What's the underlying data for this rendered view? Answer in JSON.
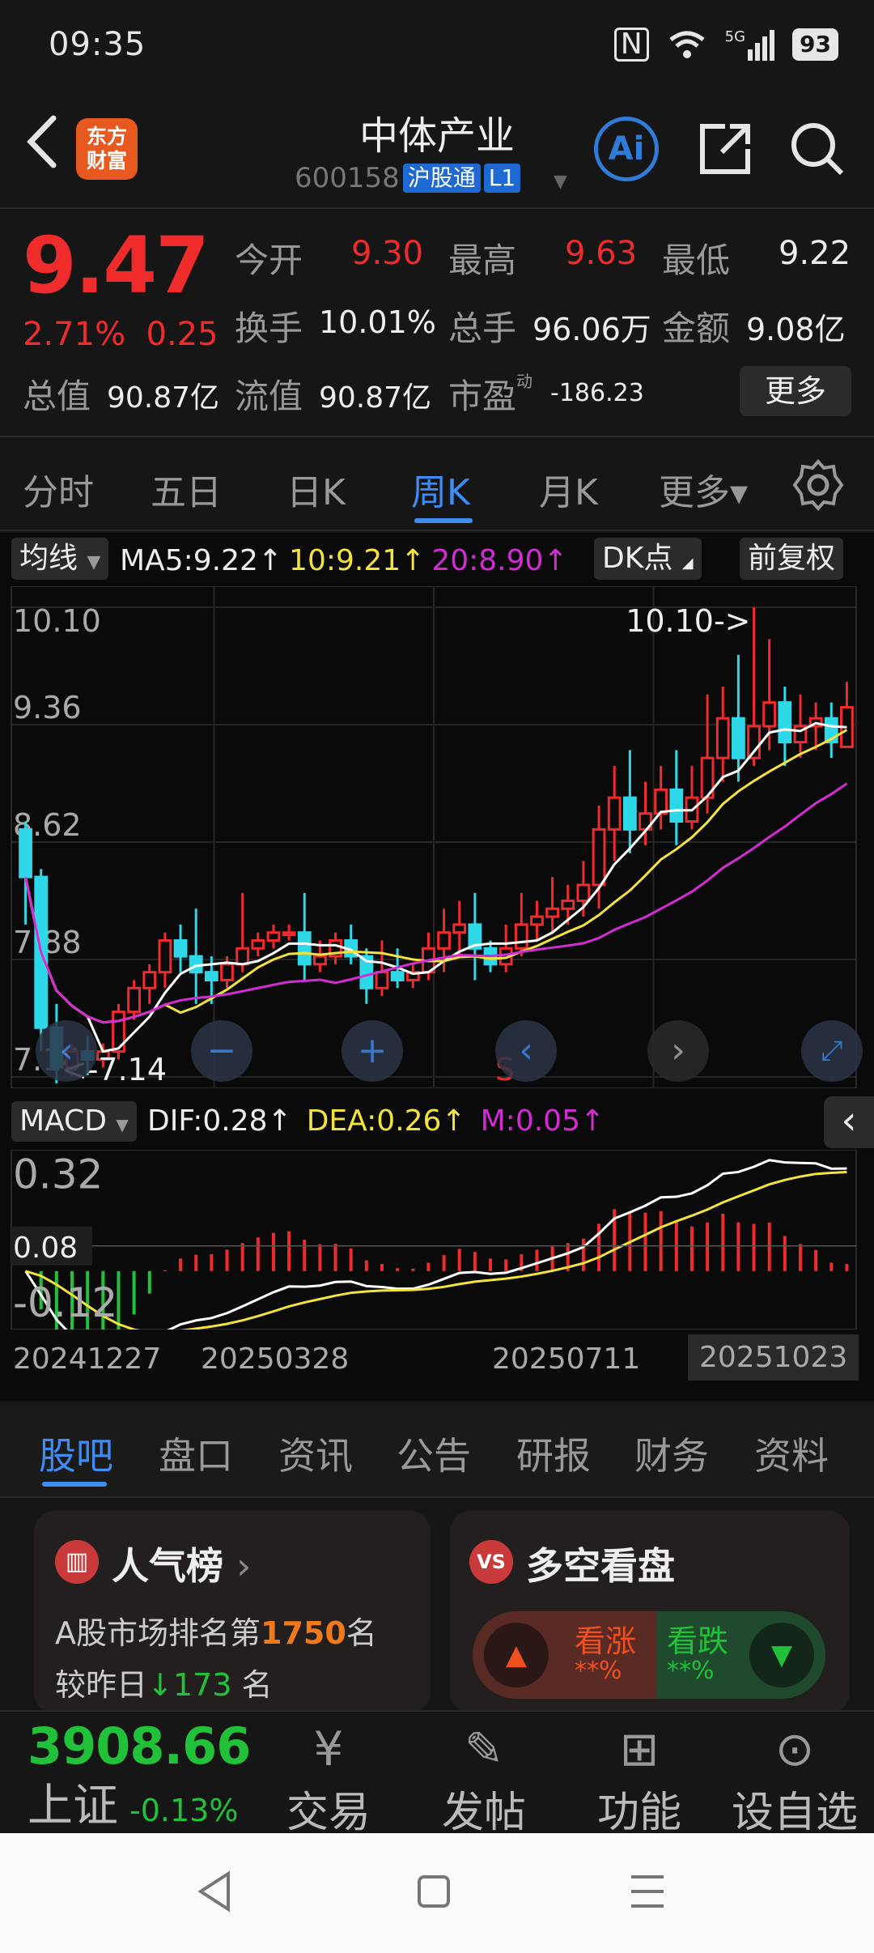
{
  "status": {
    "time": "09:35",
    "signal": "5G",
    "battery": "93"
  },
  "header": {
    "stock_name": "中体产业",
    "code": "600158",
    "tag1": "沪股通",
    "tag2": "L1",
    "logo_line1": "东方",
    "logo_line2": "财富",
    "ai_label": "Ai"
  },
  "quote": {
    "price": "9.47",
    "pct": "2.71%",
    "change": "0.25",
    "open_label": "今开",
    "open": "9.30",
    "high_label": "最高",
    "high": "9.63",
    "low_label": "最低",
    "low": "9.22",
    "turnover_label": "换手",
    "turnover": "10.01%",
    "volume_label": "总手",
    "volume": "96.06万",
    "amount_label": "金额",
    "amount": "9.08亿",
    "mktcap_label": "总值",
    "mktcap": "90.87亿",
    "float_label": "流值",
    "float_cap": "90.87亿",
    "pe_label": "市盈",
    "pe_sup": "动",
    "pe": "-186.23",
    "more": "更多"
  },
  "period_tabs": [
    "分时",
    "五日",
    "日K",
    "周K",
    "月K",
    "更多▾"
  ],
  "active_period": "周K",
  "chart": {
    "ma_btn": "均线",
    "ma5": "MA5:9.22↑",
    "ma10": "10:9.21↑",
    "ma20": "20:8.90↑",
    "dk_btn": "DK点",
    "adj_btn": "前复权",
    "high_mark": "10.10->",
    "low_mark": "<-7.14",
    "s_mark": "S",
    "y_labels": [
      "10.10",
      "9.36",
      "8.62",
      "7.88",
      "7.14"
    ],
    "macd_btn": "MACD",
    "dif": "DIF:0.28↑",
    "dea": "DEA:0.26↑",
    "m": "M:0.05↑",
    "macd_labels": [
      "0.32",
      "0.08",
      "-0.12"
    ],
    "x_labels": [
      "20241227",
      "20250328",
      "20250711",
      "20251023"
    ],
    "colors": {
      "up": "#f02b2b",
      "down": "#2fd8e8",
      "ma5": "#ffffff",
      "ma10": "#f3e33a",
      "ma20": "#d22cd2"
    }
  },
  "chart_data": {
    "type": "candlestick",
    "title": "中体产业 周K",
    "ylim": [
      7.14,
      10.1
    ],
    "x_labels": [
      "20241227",
      "20250328",
      "20250711",
      "20251023"
    ],
    "candles": [
      [
        8.7,
        8.4,
        8.75,
        8.1
      ],
      [
        8.4,
        7.45,
        8.45,
        7.3
      ],
      [
        7.45,
        7.2,
        7.6,
        7.1
      ],
      [
        7.2,
        7.3,
        7.35,
        7.14
      ],
      [
        7.3,
        7.25,
        7.4,
        7.15
      ],
      [
        7.25,
        7.3,
        7.35,
        7.2
      ],
      [
        7.3,
        7.55,
        7.6,
        7.25
      ],
      [
        7.55,
        7.7,
        7.75,
        7.5
      ],
      [
        7.7,
        7.8,
        7.85,
        7.6
      ],
      [
        7.8,
        8.0,
        8.05,
        7.7
      ],
      [
        8.0,
        7.9,
        8.1,
        7.8
      ],
      [
        7.9,
        7.8,
        8.2,
        7.6
      ],
      [
        7.8,
        7.75,
        7.9,
        7.6
      ],
      [
        7.75,
        7.85,
        7.9,
        7.7
      ],
      [
        7.85,
        7.95,
        8.3,
        7.8
      ],
      [
        7.95,
        8.0,
        8.05,
        7.9
      ],
      [
        8.0,
        8.05,
        8.1,
        7.95
      ],
      [
        8.05,
        8.05,
        8.1,
        8.0
      ],
      [
        8.05,
        7.85,
        8.3,
        7.75
      ],
      [
        7.85,
        7.9,
        8.0,
        7.8
      ],
      [
        7.9,
        8.0,
        8.05,
        7.85
      ],
      [
        8.0,
        7.9,
        8.1,
        7.85
      ],
      [
        7.9,
        7.7,
        7.95,
        7.6
      ],
      [
        7.7,
        7.8,
        8.0,
        7.65
      ],
      [
        7.8,
        7.75,
        7.95,
        7.7
      ],
      [
        7.75,
        7.8,
        7.85,
        7.7
      ],
      [
        7.8,
        7.95,
        8.05,
        7.75
      ],
      [
        7.95,
        8.05,
        8.2,
        7.8
      ],
      [
        8.05,
        8.1,
        8.25,
        7.9
      ],
      [
        8.1,
        7.95,
        8.3,
        7.75
      ],
      [
        7.95,
        7.85,
        8.0,
        7.8
      ],
      [
        7.85,
        7.95,
        8.1,
        7.8
      ],
      [
        7.95,
        8.1,
        8.3,
        7.9
      ],
      [
        8.1,
        8.15,
        8.25,
        8.0
      ],
      [
        8.15,
        8.2,
        8.4,
        8.05
      ],
      [
        8.2,
        8.25,
        8.35,
        8.1
      ],
      [
        8.25,
        8.35,
        8.5,
        8.15
      ],
      [
        8.35,
        8.7,
        8.85,
        8.2
      ],
      [
        8.7,
        8.9,
        9.1,
        8.5
      ],
      [
        8.9,
        8.7,
        9.2,
        8.55
      ],
      [
        8.7,
        8.8,
        9.0,
        8.6
      ],
      [
        8.8,
        8.95,
        9.1,
        8.7
      ],
      [
        8.95,
        8.75,
        9.2,
        8.6
      ],
      [
        8.75,
        8.9,
        9.1,
        8.7
      ],
      [
        8.9,
        9.15,
        9.55,
        8.8
      ],
      [
        9.15,
        9.4,
        9.6,
        9.0
      ],
      [
        9.4,
        9.15,
        9.8,
        9.0
      ],
      [
        9.15,
        9.35,
        10.1,
        9.1
      ],
      [
        9.35,
        9.5,
        9.9,
        9.2
      ],
      [
        9.5,
        9.25,
        9.6,
        9.1
      ],
      [
        9.25,
        9.35,
        9.55,
        9.15
      ],
      [
        9.35,
        9.4,
        9.5,
        9.2
      ],
      [
        9.4,
        9.25,
        9.5,
        9.15
      ],
      [
        9.22,
        9.47,
        9.63,
        9.22
      ]
    ],
    "macd_ylim": [
      -0.16,
      0.36
    ]
  },
  "feed_tabs": [
    "股吧",
    "盘口",
    "资讯",
    "公告",
    "研报",
    "财务",
    "资料"
  ],
  "cards": {
    "rank_title": "人气榜",
    "rank_line_a": "A股市场排名第",
    "rank_num": "1750",
    "rank_line_b": "名",
    "rank_delta_label": "较昨日",
    "rank_delta": "173",
    "rank_delta_unit": "名",
    "vs_title": "多空看盘",
    "bull": "看涨",
    "bull_pct": "**%",
    "bear": "看跌",
    "bear_pct": "**%"
  },
  "bottom": {
    "index_value": "3908.66",
    "index_name": "上证",
    "index_change": "-0.13%",
    "nav": [
      "交易",
      "发帖",
      "功能",
      "设自选"
    ]
  }
}
